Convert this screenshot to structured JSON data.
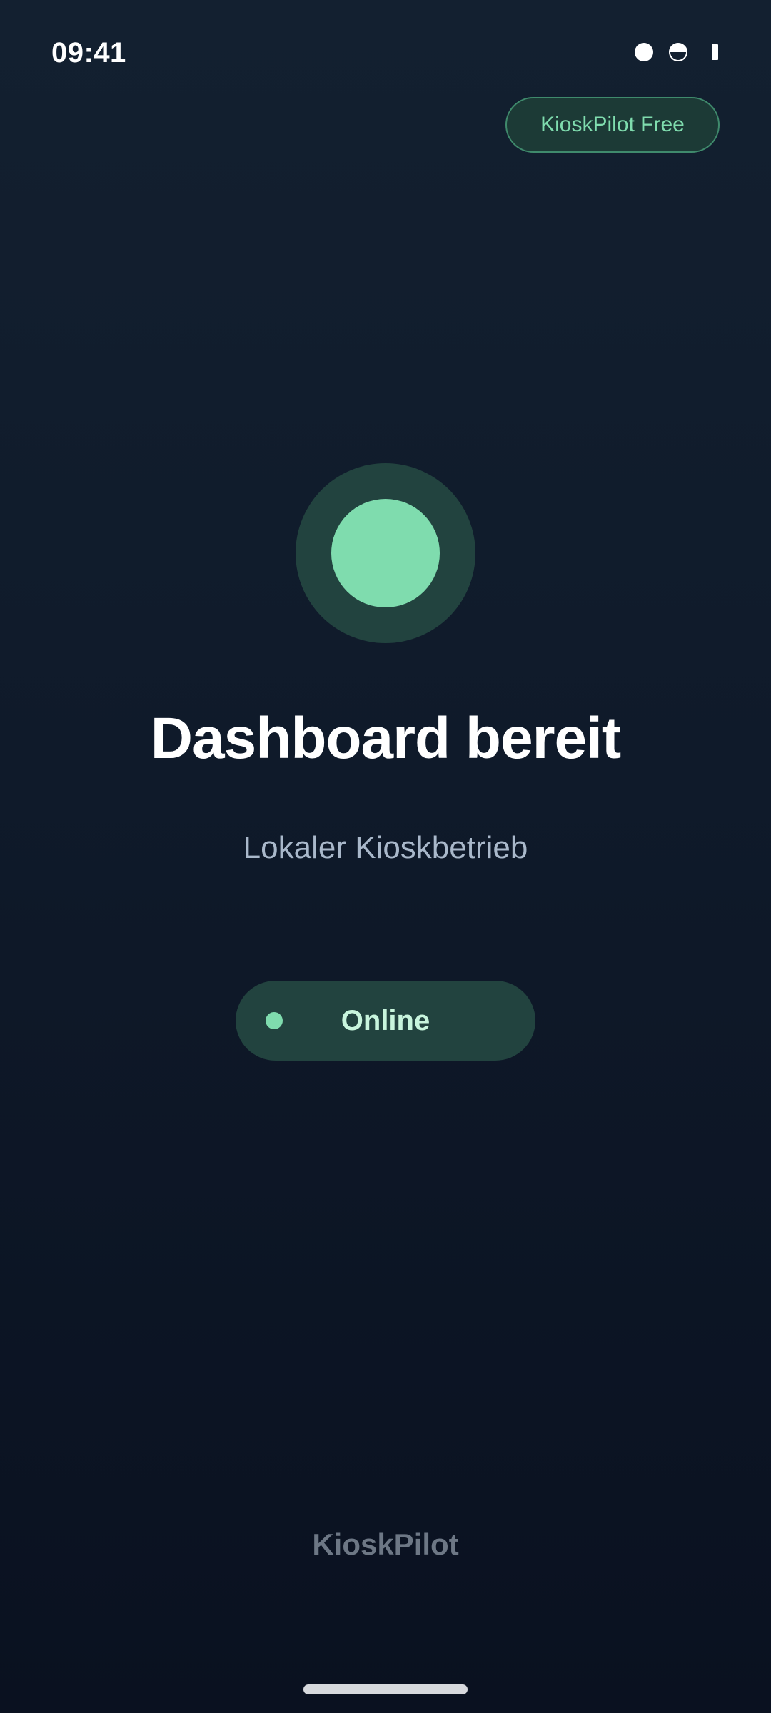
{
  "status_bar": {
    "time": "09:41",
    "icons": [
      "circle-icon",
      "half-circle-icon",
      "battery-icon"
    ]
  },
  "header": {
    "plan_badge": "KioskPilot Free"
  },
  "main": {
    "title": "Dashboard bereit",
    "subtitle": "Lokaler Kioskbetrieb",
    "status": {
      "label": "Online",
      "color": "#7fdcae"
    }
  },
  "footer": {
    "brand": "KioskPilot"
  },
  "colors": {
    "accent": "#7fdcae",
    "accent_dark": "#22433f",
    "background": "#0f1a2a"
  }
}
